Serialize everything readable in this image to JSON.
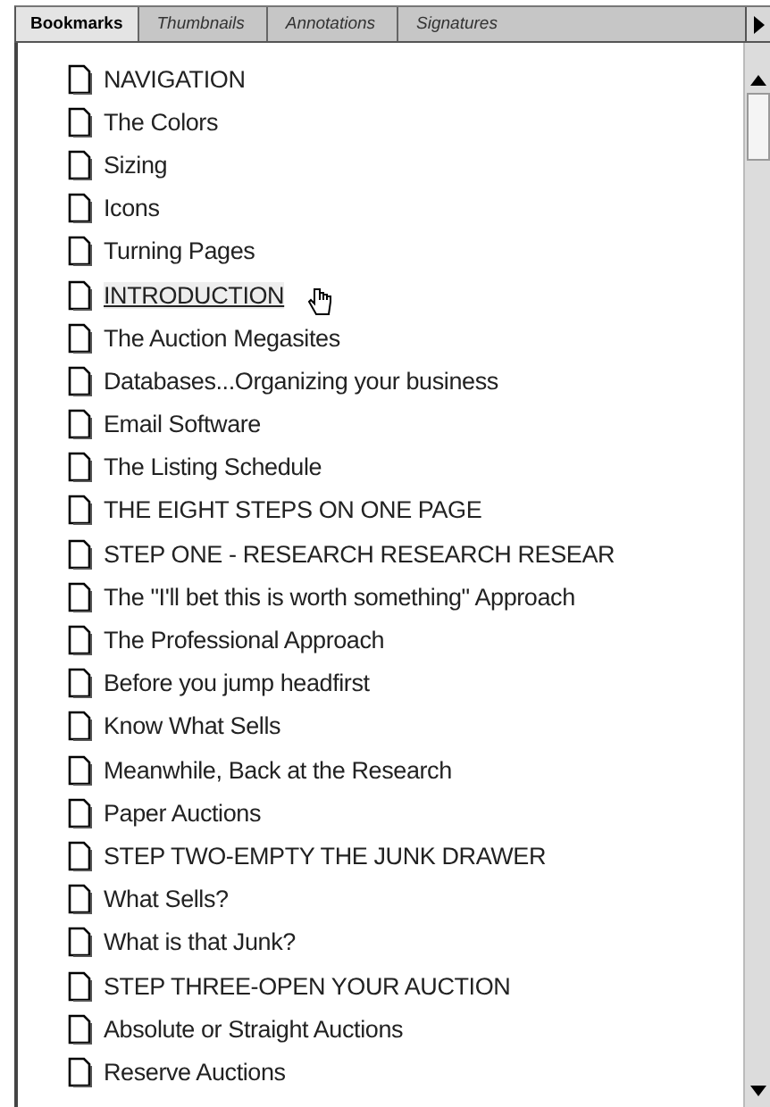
{
  "tabs": [
    {
      "label": "Bookmarks",
      "selected": true
    },
    {
      "label": "Thumbnails",
      "selected": false
    },
    {
      "label": "Annotations",
      "selected": false
    },
    {
      "label": "Signatures",
      "selected": false
    }
  ],
  "bookmarks": [
    {
      "title": "NAVIGATION",
      "selected": false
    },
    {
      "title": "The Colors",
      "selected": false
    },
    {
      "title": "Sizing",
      "selected": false
    },
    {
      "title": "Icons",
      "selected": false
    },
    {
      "title": "Turning Pages",
      "selected": false
    },
    {
      "title": "INTRODUCTION",
      "selected": true
    },
    {
      "title": "The Auction Megasites",
      "selected": false
    },
    {
      "title": "Databases...Organizing your business",
      "selected": false
    },
    {
      "title": "Email Software",
      "selected": false
    },
    {
      "title": "The Listing Schedule",
      "selected": false
    },
    {
      "title": "THE EIGHT STEPS ON ONE PAGE",
      "selected": false
    },
    {
      "title": "STEP ONE - RESEARCH RESEARCH RESEAR",
      "selected": false
    },
    {
      "title": "The \"I'll bet this is worth something\" Approach",
      "selected": false
    },
    {
      "title": "The Professional Approach",
      "selected": false
    },
    {
      "title": "Before you jump headfirst",
      "selected": false
    },
    {
      "title": "Know What Sells",
      "selected": false
    },
    {
      "title": "Meanwhile, Back at the Research",
      "selected": false
    },
    {
      "title": "Paper Auctions",
      "selected": false
    },
    {
      "title": "STEP TWO-EMPTY THE JUNK DRAWER",
      "selected": false
    },
    {
      "title": "What Sells?",
      "selected": false
    },
    {
      "title": "What is that Junk?",
      "selected": false
    },
    {
      "title": "STEP THREE-OPEN YOUR AUCTION",
      "selected": false
    },
    {
      "title": "Absolute or Straight Auctions",
      "selected": false
    },
    {
      "title": "Reserve Auctions",
      "selected": false
    }
  ]
}
